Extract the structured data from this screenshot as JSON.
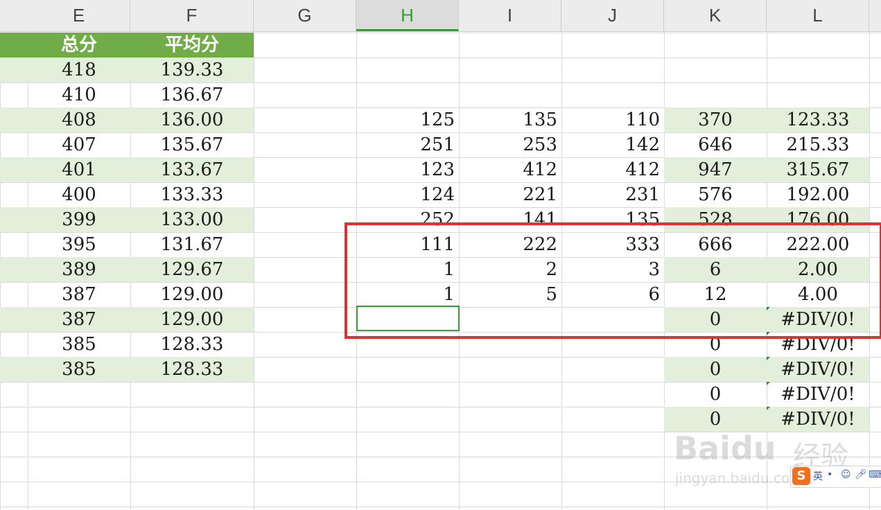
{
  "columns": [
    "E",
    "F",
    "G",
    "H",
    "I",
    "J",
    "K",
    "L"
  ],
  "selected_column": "H",
  "left_table": {
    "header": {
      "total": "总分",
      "avg": "平均分"
    },
    "rows": [
      {
        "total": "418",
        "avg": "139.33"
      },
      {
        "total": "410",
        "avg": "136.67"
      },
      {
        "total": "408",
        "avg": "136.00"
      },
      {
        "total": "407",
        "avg": "135.67"
      },
      {
        "total": "401",
        "avg": "133.67"
      },
      {
        "total": "400",
        "avg": "133.33"
      },
      {
        "total": "399",
        "avg": "133.00"
      },
      {
        "total": "395",
        "avg": "131.67"
      },
      {
        "total": "389",
        "avg": "129.67"
      },
      {
        "total": "387",
        "avg": "129.00"
      },
      {
        "total": "387",
        "avg": "129.00"
      },
      {
        "total": "385",
        "avg": "128.33"
      },
      {
        "total": "385",
        "avg": "128.33"
      }
    ]
  },
  "right_table": {
    "rows": [
      {
        "h": "125",
        "i": "135",
        "j": "110",
        "k": "370",
        "l": "123.33"
      },
      {
        "h": "251",
        "i": "253",
        "j": "142",
        "k": "646",
        "l": "215.33"
      },
      {
        "h": "123",
        "i": "412",
        "j": "412",
        "k": "947",
        "l": "315.67"
      },
      {
        "h": "124",
        "i": "221",
        "j": "231",
        "k": "576",
        "l": "192.00"
      },
      {
        "h": "252",
        "i": "141",
        "j": "135",
        "k": "528",
        "l": "176.00"
      },
      {
        "h": "111",
        "i": "222",
        "j": "333",
        "k": "666",
        "l": "222.00"
      },
      {
        "h": "1",
        "i": "2",
        "j": "3",
        "k": "6",
        "l": "2.00"
      },
      {
        "h": "1",
        "i": "5",
        "j": "6",
        "k": "12",
        "l": "4.00"
      },
      {
        "h": "",
        "i": "",
        "j": "",
        "k": "0",
        "l": "#DIV/0!"
      },
      {
        "h": "",
        "i": "",
        "j": "",
        "k": "0",
        "l": "#DIV/0!"
      },
      {
        "h": "",
        "i": "",
        "j": "",
        "k": "0",
        "l": "#DIV/0!"
      },
      {
        "h": "",
        "i": "",
        "j": "",
        "k": "0",
        "l": "#DIV/0!"
      },
      {
        "h": "",
        "i": "",
        "j": "",
        "k": "0",
        "l": "#DIV/0!"
      }
    ]
  },
  "watermark": {
    "brand": "Baidu",
    "brand_cn": "经验",
    "url": "jingyan.baidu.com"
  },
  "ime": {
    "logo": "S",
    "lang": "英"
  },
  "colors": {
    "header_green": "#70ad47",
    "band_green": "#e2efda",
    "highlight_red": "#e03030",
    "selection_green": "#3a9a3a"
  }
}
